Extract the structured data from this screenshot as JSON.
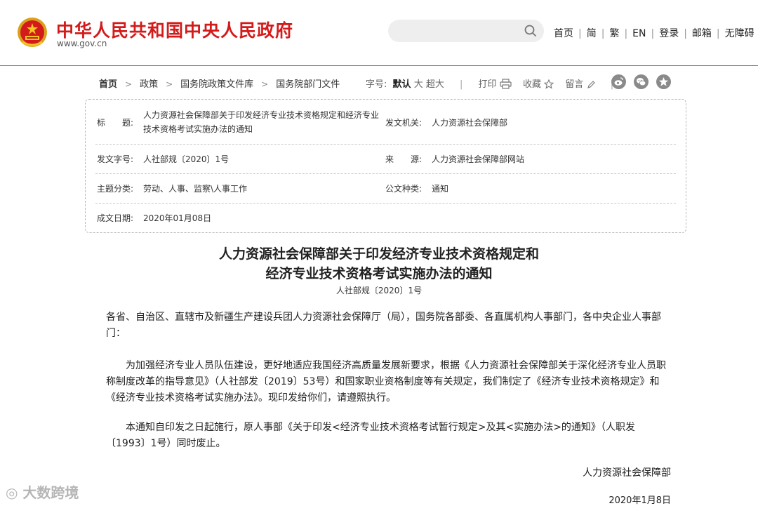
{
  "header": {
    "site_title": "中华人民共和国中央人民政府",
    "site_url": "www.gov.cn",
    "search": {
      "placeholder": "",
      "value": ""
    },
    "nav": [
      "首页",
      "简",
      "繁",
      "EN",
      "登录",
      "邮箱",
      "无障碍"
    ]
  },
  "breadcrumb": [
    "首页",
    "政策",
    "国务院政策文件库",
    "国务院部门文件"
  ],
  "toolbar": {
    "font_size_label": "字号:",
    "font_sizes": [
      "默认",
      "大",
      "超大"
    ],
    "print": "打印",
    "favorite": "收藏",
    "comment": "留言"
  },
  "metadata": {
    "title_label": "标　　题:",
    "title_value": "人力资源社会保障部关于印发经济专业技术资格规定和经济专业技术资格考试实施办法的通知",
    "issuer_label": "发文机关:",
    "issuer_value": "人力资源社会保障部",
    "docno_label": "发文字号:",
    "docno_value": "人社部规〔2020〕1号",
    "source_label": "来　　源:",
    "source_value": "人力资源社会保障部网站",
    "topic_label": "主题分类:",
    "topic_value": "劳动、人事、监察\\人事工作",
    "type_label": "公文种类:",
    "type_value": "通知",
    "date_label": "成文日期:",
    "date_value": "2020年01月08日"
  },
  "article": {
    "title_line1": "人力资源社会保障部关于印发经济专业技术资格规定和",
    "title_line2": "经济专业技术资格考试实施办法的通知",
    "doc_no": "人社部规〔2020〕1号",
    "p1": "各省、自治区、直辖市及新疆生产建设兵团人力资源社会保障厅（局），国务院各部委、各直属机构人事部门，各中央企业人事部门：",
    "p2": "　　为加强经济专业人员队伍建设，更好地适应我国经济高质量发展新要求，根据《人力资源社会保障部关于深化经济专业人员职称制度改革的指导意见》（人社部发〔2019〕53号）和国家职业资格制度等有关规定，我们制定了《经济专业技术资格规定》和《经济专业技术资格考试实施办法》。现印发给你们，请遵照执行。",
    "p3": "　　本通知自印发之日起施行，原人事部《关于印发<经济专业技术资格考试暂行规定>及其<实施办法>的通知》（人职发〔1993〕1号）同时废止。",
    "signer": "人力资源社会保障部",
    "sign_date": "2020年1月8日"
  },
  "watermark": "大数跨境",
  "colors": {
    "brand_red": "#d31b1b",
    "header_line": "#5f86b3",
    "icon_gray": "#8a8a8a"
  }
}
